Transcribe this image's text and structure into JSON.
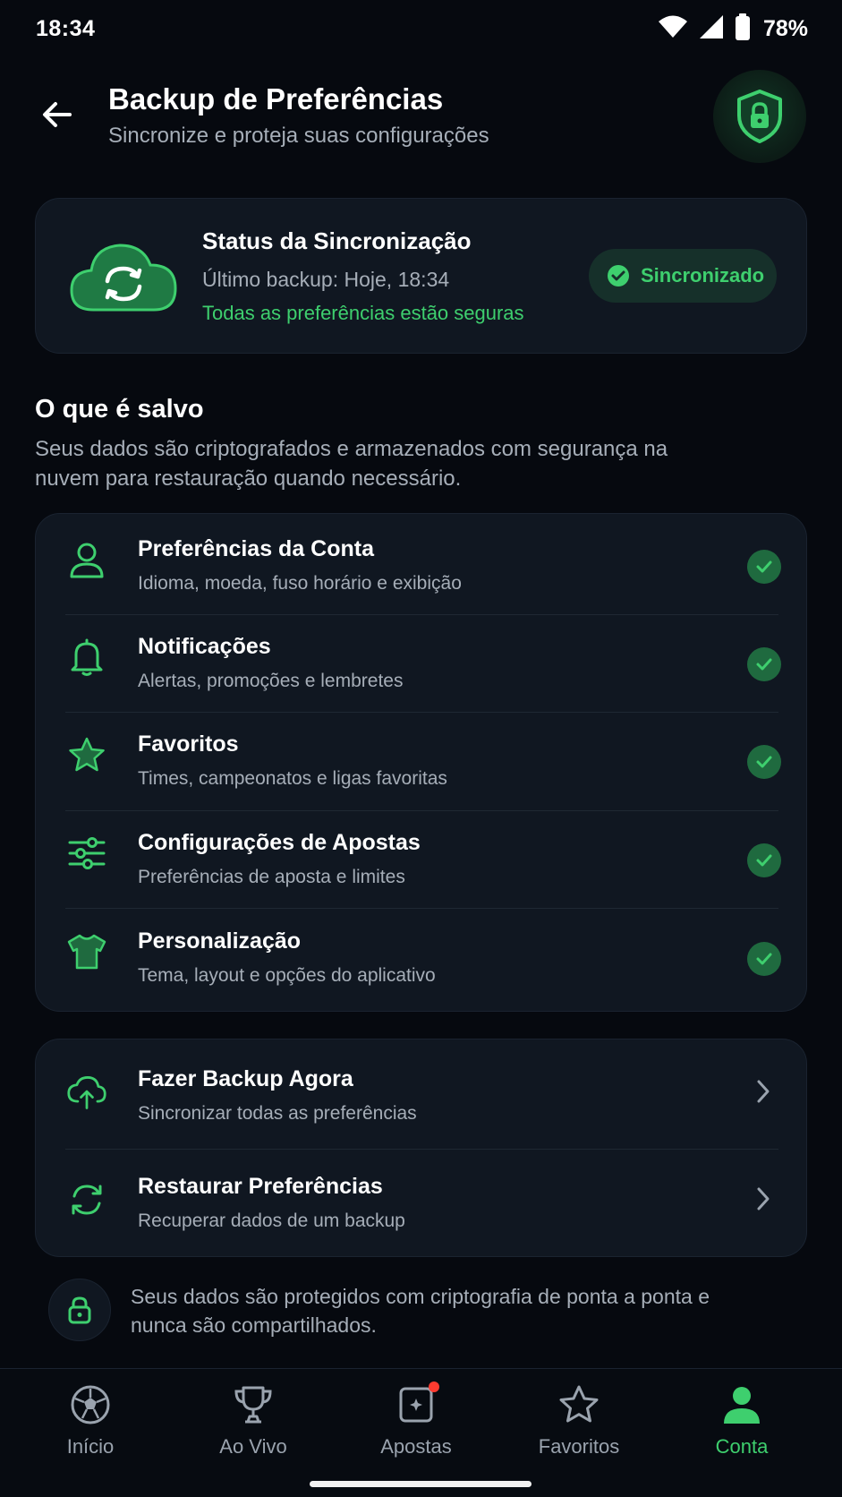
{
  "status_bar": {
    "time": "18:34",
    "battery": "78%"
  },
  "header": {
    "title": "Backup de Preferências",
    "subtitle": "Sincronize e proteja suas configurações"
  },
  "sync_status": {
    "title": "Status da Sincronização",
    "last_backup": "Último backup: Hoje, 18:34",
    "safe_message": "Todas as preferências estão seguras",
    "badge": "Sincronizado"
  },
  "saved_section": {
    "title": "O que é salvo",
    "description": "Seus dados são criptografados e armazenados com segurança na nuvem para restauração quando necessário.",
    "items": [
      {
        "icon": "user-icon",
        "title": "Preferências da Conta",
        "subtitle": "Idioma, moeda, fuso horário e exibição",
        "checked": true
      },
      {
        "icon": "bell-icon",
        "title": "Notificações",
        "subtitle": "Alertas, promoções e lembretes",
        "checked": true
      },
      {
        "icon": "star-icon",
        "title": "Favoritos",
        "subtitle": "Times, campeonatos e ligas favoritas",
        "checked": true
      },
      {
        "icon": "sliders-icon",
        "title": "Configurações de Apostas",
        "subtitle": "Preferências de aposta e limites",
        "checked": true
      },
      {
        "icon": "shirt-icon",
        "title": "Personalização",
        "subtitle": "Tema, layout e opções do aplicativo",
        "checked": true
      }
    ]
  },
  "actions": [
    {
      "icon": "cloud-upload-icon",
      "title": "Fazer Backup Agora",
      "subtitle": "Sincronizar todas as preferências"
    },
    {
      "icon": "restore-icon",
      "title": "Restaurar Preferências",
      "subtitle": "Recuperar dados de um backup"
    }
  ],
  "footer_note": "Seus dados são protegidos com criptografia de ponta a ponta e nunca são compartilhados.",
  "bottom_nav": {
    "items": [
      {
        "icon": "soccer-ball-icon",
        "label": "Início",
        "active": false
      },
      {
        "icon": "trophy-icon",
        "label": "Ao Vivo",
        "active": false
      },
      {
        "icon": "ticket-icon",
        "label": "Apostas",
        "active": false,
        "badge": true
      },
      {
        "icon": "star-icon",
        "label": "Favoritos",
        "active": false
      },
      {
        "icon": "person-icon",
        "label": "Conta",
        "active": true
      }
    ]
  },
  "colors": {
    "background": "#06090f",
    "card": "#101721",
    "accent": "#3ecf6e",
    "muted_text": "#a6aeb8"
  }
}
